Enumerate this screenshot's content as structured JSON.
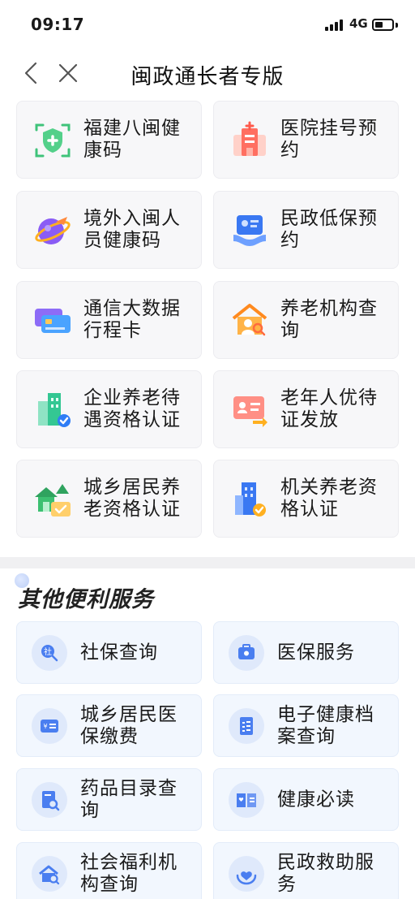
{
  "status_bar": {
    "time": "09:17",
    "network": "4G"
  },
  "nav": {
    "title": "闽政通长者专版"
  },
  "top_services": [
    {
      "label": "福建八闽健康码",
      "icon": "health-code-shield-icon"
    },
    {
      "label": "医院挂号预约",
      "icon": "hospital-icon"
    },
    {
      "label": "境外入闽人员健康码",
      "icon": "plane-globe-icon"
    },
    {
      "label": "民政低保预约",
      "icon": "id-card-hand-icon"
    },
    {
      "label": "通信大数据行程卡",
      "icon": "cards-icon"
    },
    {
      "label": "养老机构查询",
      "icon": "house-search-icon"
    },
    {
      "label": "企业养老待遇资格认证",
      "icon": "building-check-icon"
    },
    {
      "label": "老年人优待证发放",
      "icon": "certificate-arrow-icon"
    },
    {
      "label": "城乡居民养老资格认证",
      "icon": "village-check-icon"
    },
    {
      "label": "机关养老资格认证",
      "icon": "office-check-icon"
    }
  ],
  "other_section": {
    "title": "其他便利服务"
  },
  "other_services": [
    {
      "label": "社保查询",
      "icon": "social-security-search-icon"
    },
    {
      "label": "医保服务",
      "icon": "medical-kit-icon"
    },
    {
      "label": "城乡居民医保缴费",
      "icon": "payment-card-icon"
    },
    {
      "label": "电子健康档案查询",
      "icon": "health-file-icon"
    },
    {
      "label": "药品目录查询",
      "icon": "drug-catalog-search-icon"
    },
    {
      "label": "健康必读",
      "icon": "health-book-icon"
    },
    {
      "label": "社会福利机构查询",
      "icon": "welfare-house-search-icon"
    },
    {
      "label": "民政救助服务",
      "icon": "heart-hands-icon"
    }
  ]
}
